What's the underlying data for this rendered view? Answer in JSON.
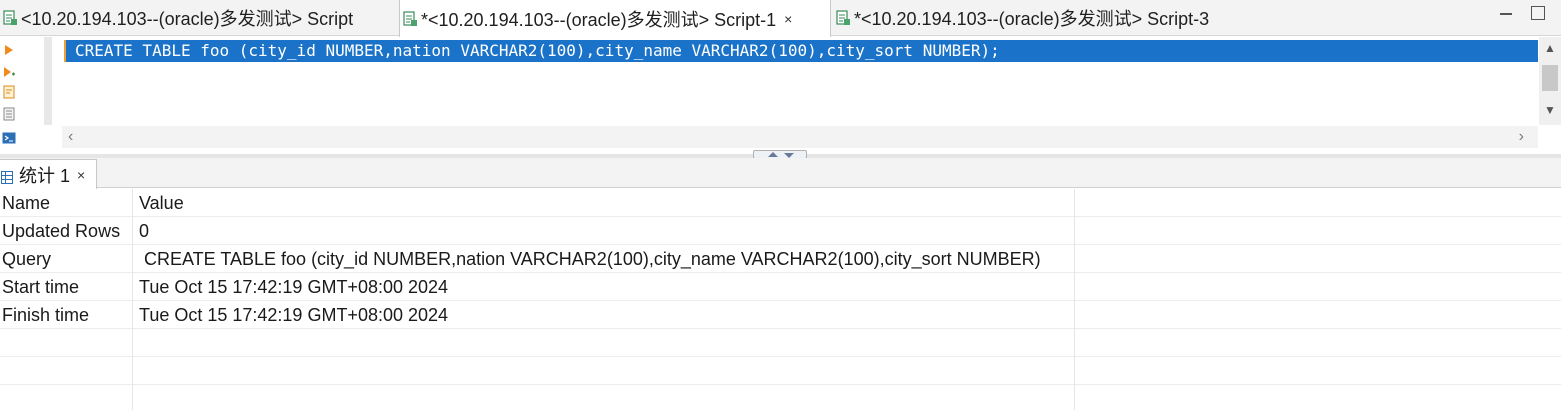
{
  "editor_tabs": [
    {
      "label": "<10.20.194.103--(oracle)多发测试> Script",
      "active": false,
      "closable": false
    },
    {
      "label": "*<10.20.194.103--(oracle)多发测试> Script-1",
      "active": true,
      "closable": true,
      "close": "×"
    },
    {
      "label": "*<10.20.194.103--(oracle)多发测试> Script-3",
      "active": false,
      "closable": false
    }
  ],
  "editor": {
    "sql": "CREATE TABLE foo (city_id NUMBER,nation VARCHAR2(100),city_name VARCHAR2(100),city_sort NUMBER);",
    "selection_color": "#1a73c8"
  },
  "result_tab": {
    "label": "统计 1",
    "close": "×"
  },
  "stats": {
    "header": {
      "name": "Name",
      "value": "Value"
    },
    "rows": [
      {
        "name": "Updated Rows",
        "value": "0"
      },
      {
        "name": "Query",
        "value": " CREATE TABLE foo (city_id NUMBER,nation VARCHAR2(100),city_name VARCHAR2(100),city_sort NUMBER)"
      },
      {
        "name": "Start time",
        "value": "Tue Oct 15 17:42:19 GMT+08:00 2024"
      },
      {
        "name": "Finish time",
        "value": "Tue Oct 15 17:42:19 GMT+08:00 2024"
      }
    ]
  },
  "icons": {
    "tab": "sql-script-icon",
    "gutter": [
      "execute-statement-icon",
      "execute-script-icon",
      "explain-plan-icon",
      "history-icon",
      "terminal-icon"
    ],
    "result": "table-grid-icon"
  }
}
